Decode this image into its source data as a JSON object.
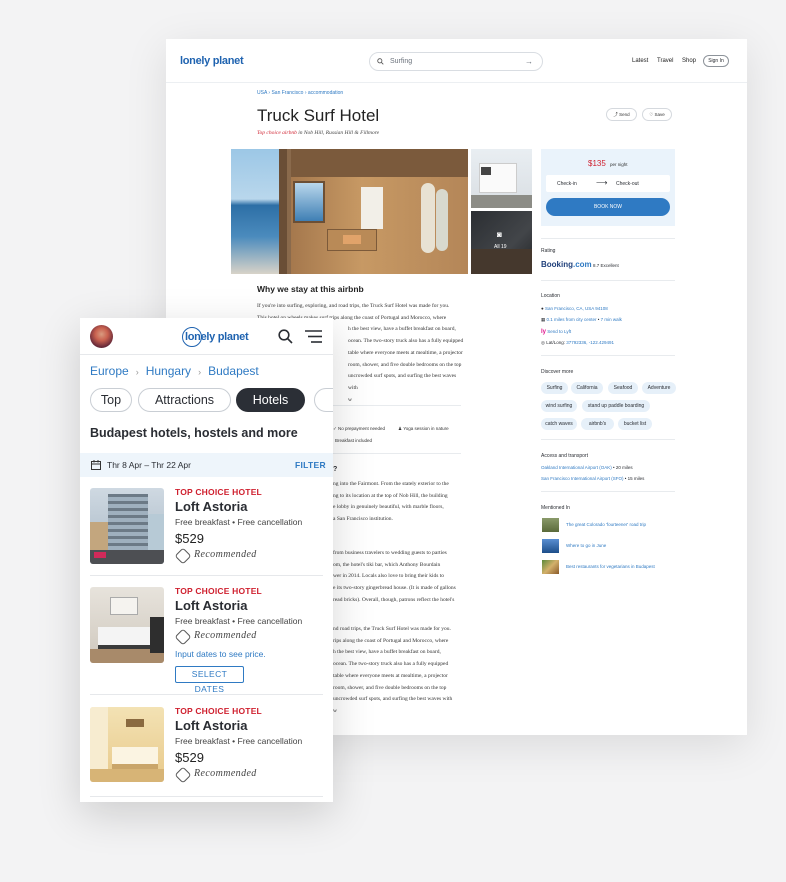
{
  "desktop": {
    "logo": "lonely planet",
    "search": {
      "value": "Surfing"
    },
    "nav": [
      "Latest",
      "Travel",
      "Shop"
    ],
    "signin": "Sign In",
    "breadcrumb": [
      "USA",
      "San Francisco",
      "accommodation"
    ],
    "title": "Truck Surf Hotel",
    "subtitle_red": "Top choice airbnb",
    "subtitle_rest": " in Nob Hill, Russian Hill & Fillmore",
    "send": "Send",
    "save": "Save",
    "photo_count": "All 19",
    "booking": {
      "price": "$135",
      "per": "per night",
      "checkin": "Check-in",
      "checkout": "Check-out",
      "button": "BOOK NOW"
    },
    "why_title": "Why we stay at this airbnb",
    "p1": [
      "If you're into surfing, exploring, and road trips, the Truck Surf Hotel was made for you.",
      "This hotel on wheels makes surf trips along the coast of Portugal and Morocco, where",
      "h the best view, have a buffet breakfast on board,",
      "ocean. The two-story truck also has a fully equipped",
      "table where everyone meets at mealtime, a projector",
      "room, shower, and five double bedrooms on the top",
      "uncrowded surf spots, and surfing the best waves with",
      "w"
    ],
    "amen": [
      "No prepayment needed",
      "Yoga session in nature",
      "Breakfast included"
    ],
    "q": "?",
    "p2": [
      "ng into the Fairmont. From the stately exterior to the",
      "ng to its location at the top of Nob Hill, the building",
      "e lobby in genuinely beautiful, with marble floors,",
      "a San Francisco institution."
    ],
    "p3": [
      "from business travelers to wedding guests to parties",
      "om, the hotel's tiki bar, which Anthony Bourdain",
      "wer in 2014. Locals also love to bring their kids to",
      "e its two-story gingerbread house. (It is made of gallons",
      "read bricks). Overall, though, patrons reflect the hotel's"
    ],
    "p4": [
      "nd road trips, the Truck Surf Hotel was made for you.",
      "rips along the coast of Portugal and Morocco, where",
      "h the best view, have a buffet breakfast on board,",
      "ocean. The two-story truck also has a fully equipped",
      "table where everyone meets at mealtime, a projector",
      "room, shower, and five double bedrooms on the top",
      "uncrowded surf spots, and surfing the best waves with",
      "w"
    ],
    "rating": {
      "label": "Rating",
      "brand": "Booking",
      "brand2": ".com",
      "score": "8.7",
      "word": "Excellent"
    },
    "location": {
      "label": "Location",
      "addr": "San Francisco, CA, USA 94108",
      "dist": "0.1 miles from city center",
      "walk": "7 min walk",
      "lyft": "Send to Lyft",
      "latlong_label": "Lat/Long: ",
      "latlong": "37792336, -122.429491"
    },
    "discover": {
      "label": "Discover more",
      "tags": [
        "Surfing",
        "California",
        "Seafood",
        "Adventure",
        "wind surfing",
        "stand up paddle boarding",
        "catch waves",
        "airbnb's",
        "bucket list"
      ]
    },
    "access": {
      "label": "Access and transport",
      "a1": "Oakland International Airport (OAK)",
      "a1d": " • 20 miles",
      "a2": "San Francisco International Airport (SFO)",
      "a2d": " • 15 miles"
    },
    "mentioned": {
      "label": "Mentioned In",
      "items": [
        "The great Colorado 'fourteener' road trip",
        "Where to go in June",
        "Best restaurants for vegetarians in Budapest"
      ]
    }
  },
  "mobile": {
    "logo": "lonely planet",
    "breadcrumb": [
      "Europe",
      "Hungary",
      "Budapest"
    ],
    "chips": [
      "Top",
      "Attractions",
      "Hotels"
    ],
    "heading": "Budapest hotels, hostels and more",
    "dates": "Thr 8 Apr – Thr 22 Apr",
    "filter": "FILTER",
    "hotels": [
      {
        "tag": "TOP CHOICE HOTEL",
        "name": "Loft Astoria",
        "features": "Free breakfast • Free cancellation",
        "price": "$529",
        "rec": "Recommended"
      },
      {
        "tag": "TOP CHOICE HOTEL",
        "name": "Loft Astoria",
        "features": "Free breakfast • Free cancellation",
        "rec": "Recommended",
        "input": "Input dates to see price.",
        "select": "SELECT DATES"
      },
      {
        "tag": "TOP CHOICE HOTEL",
        "name": "Loft Astoria",
        "features": "Free breakfast • Free cancellation",
        "price": "$529",
        "rec": "Recommended"
      }
    ]
  },
  "colors": {
    "brand": "#1f63b0",
    "accent": "#2f7ac3",
    "red": "#cf1f2e",
    "dark_chip": "#2b2f36"
  }
}
